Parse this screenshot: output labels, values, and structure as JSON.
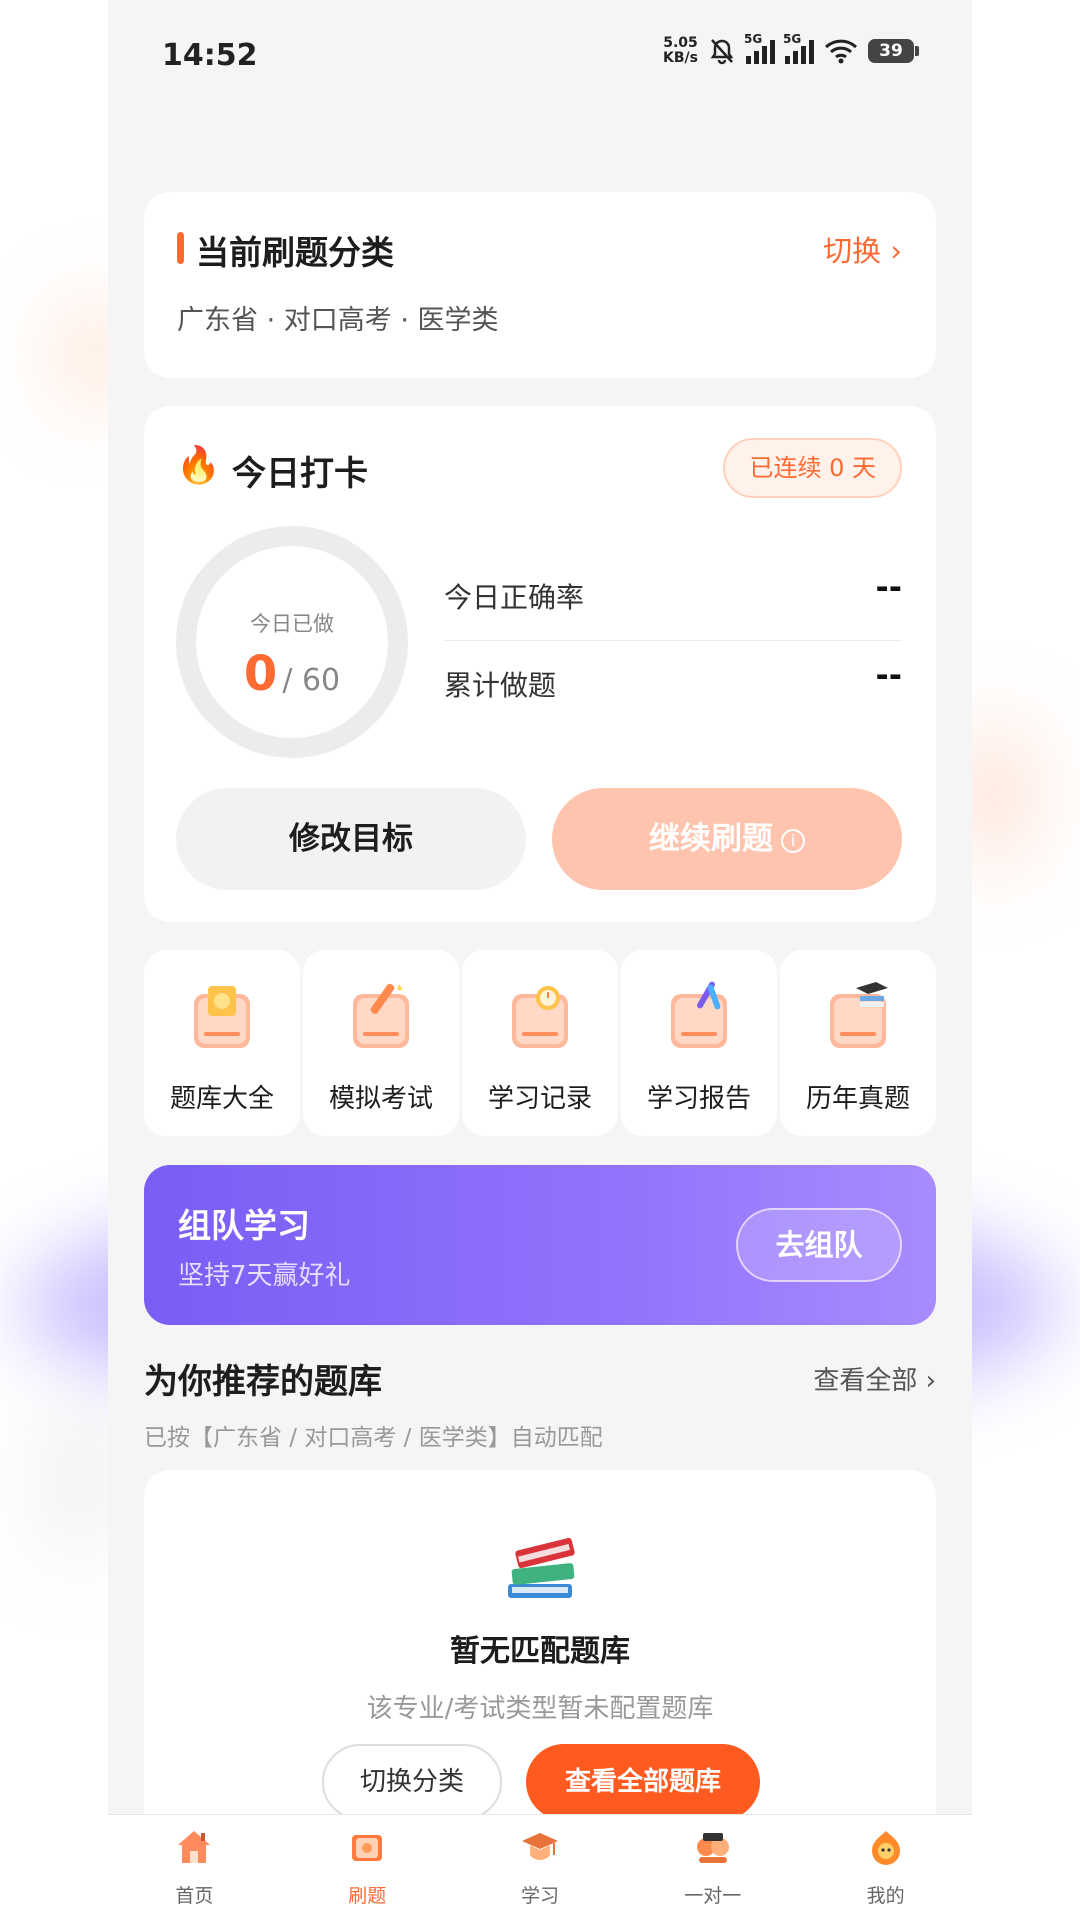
{
  "status_bar": {
    "time": "14:52",
    "net_speed_value": "5.05",
    "net_speed_unit": "KB/s",
    "signal_1_label": "5G",
    "signal_2_label": "5G",
    "battery": "39"
  },
  "category": {
    "title": "当前刷题分类",
    "switch_label": "切换 ›",
    "path": "广东省 · 对口高考 · 医学类"
  },
  "checkin": {
    "title": "今日打卡",
    "streak": "已连续 0 天",
    "ring_label": "今日已做",
    "done": "0",
    "total": "/ 60",
    "accuracy_label": "今日正确率",
    "accuracy_value": "--",
    "cumulative_label": "累计做题",
    "cumulative_value": "--",
    "goal_button": "修改目标",
    "continue_button": "继续刷题"
  },
  "features": [
    {
      "label": "题库大全",
      "icon": "question-bank-icon"
    },
    {
      "label": "模拟考试",
      "icon": "mock-exam-icon"
    },
    {
      "label": "学习记录",
      "icon": "study-record-icon"
    },
    {
      "label": "学习报告",
      "icon": "study-report-icon"
    },
    {
      "label": "历年真题",
      "icon": "past-exams-icon"
    }
  ],
  "team": {
    "title": "组队学习",
    "subtitle": "坚持7天赢好礼",
    "button": "去组队"
  },
  "recommend": {
    "title": "为你推荐的题库",
    "view_all": "查看全部 ›",
    "subtitle": "已按【广东省 / 对口高考 / 医学类】自动匹配",
    "empty_title": "暂无匹配题库",
    "empty_sub": "该专业/考试类型暂未配置题库",
    "switch_button": "切换分类",
    "view_all_button": "查看全部题库"
  },
  "tabs": [
    {
      "label": "首页"
    },
    {
      "label": "刷题",
      "active": true
    },
    {
      "label": "学习"
    },
    {
      "label": "一对一"
    },
    {
      "label": "我的"
    }
  ],
  "colors": {
    "accent": "#ff6a33",
    "team_start": "#7a5df5",
    "team_end": "#a88bff"
  }
}
